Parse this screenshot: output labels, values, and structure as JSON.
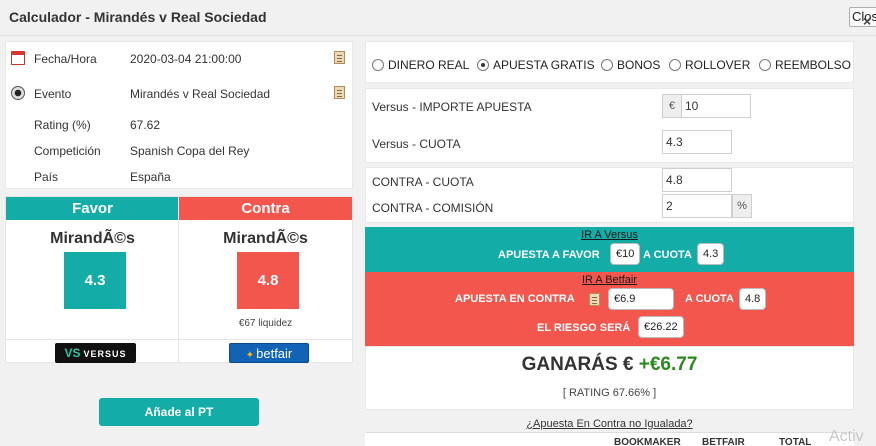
{
  "window": {
    "title": "Calculador - Mirandés v Real Sociedad",
    "close_label": "Close",
    "close_icon": "×"
  },
  "info": [
    {
      "label": "Fecha/Hora",
      "value": "2020-03-04 21:00:00"
    },
    {
      "label": "Evento",
      "value": "Mirandés v Real Sociedad"
    },
    {
      "label": "Rating (%)",
      "value": "67.62"
    },
    {
      "label": "Competición",
      "value": "Spanish Copa del Rey"
    },
    {
      "label": "País",
      "value": "España"
    }
  ],
  "favor": {
    "header": "Favor",
    "team": "MirandÃ©s",
    "odds": "4.3",
    "bookmaker": "VERSUS",
    "bookmaker_mark": "VS"
  },
  "contra": {
    "header": "Contra",
    "team": "MirandÃ©s",
    "odds": "4.8",
    "liquidity": "€67 liquidez",
    "exchange": "betfair"
  },
  "add_button": "Añade al PT",
  "bet_types": [
    "DINERO REAL",
    "APUESTA GRATIS",
    "BONOS",
    "ROLLOVER",
    "REEMBOLSO"
  ],
  "selected_bet_type": "APUESTA GRATIS",
  "versus_form": {
    "stake_label": "Versus - IMPORTE APUESTA",
    "currency": "€",
    "stake": "10",
    "odds_label": "Versus - CUOTA",
    "odds": "4.3"
  },
  "contra_form": {
    "odds_label": "CONTRA - CUOTA",
    "odds": "4.8",
    "commission_label": "CONTRA - COMISIÓN",
    "commission": "2",
    "percent": "%"
  },
  "versus_band": {
    "link": "IR A Versus",
    "bet_label": "APUESTA A FAVOR",
    "amount": "€10",
    "odds_label": "A CUOTA",
    "odds": "4.3"
  },
  "betfair_band": {
    "link": "IR A Betfair",
    "bet_label": "APUESTA EN CONTRA",
    "amount": "€6.9",
    "odds_label": "A CUOTA",
    "odds": "4.8",
    "risk_label": "EL RIESGO SERÁ",
    "risk": "€26.22"
  },
  "result": {
    "label": "GANARÁS €",
    "profit": "+€6.77",
    "rating": "[ RATING 67.66% ]"
  },
  "unmatched_link": "¿Apuesta En Contra no Igualada?",
  "table_headers": [
    "BOOKMAKER",
    "BETFAIR",
    "TOTAL"
  ],
  "watermark": "Activ"
}
